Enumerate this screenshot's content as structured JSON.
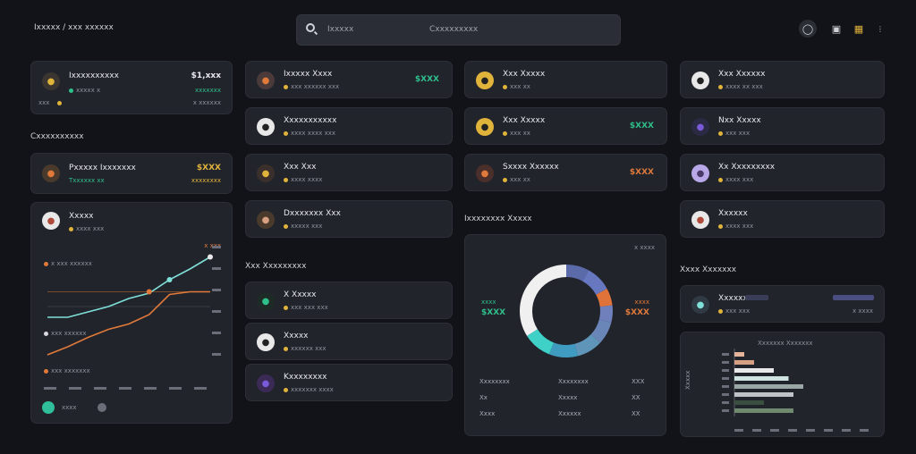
{
  "app": {
    "brand": "Ixxxxx / xxx xxxxxx"
  },
  "search": {
    "label": "Ixxxxx",
    "placeholder": "Cxxxxxxxxx"
  },
  "header": {
    "icons": [
      "globe-icon",
      "wallet-icon",
      "grid-icon",
      "more-icon"
    ]
  },
  "balance": {
    "title": "Ixxxxxxxxxx",
    "value": "$1,xxx",
    "sub": "xxxxx x",
    "sub_right": "xxxxxxx",
    "foot_left": "xxx",
    "foot_right": "x xxxxxx"
  },
  "col1": {
    "section_title": "Cxxxxxxxxxx",
    "top_card": {
      "title": "Pxxxxx Ixxxxxxx",
      "value": "$XXX",
      "sub": "Txxxxxx xx",
      "sub_right": "xxxxxxxx"
    },
    "chart_card": {
      "title": "Xxxxx",
      "sub": "xxxx xxx",
      "legend_1": "x xxx xxxxxx",
      "legend_2": "xxx xxxxxx",
      "legend_3": "xxx xxxxxxx",
      "corner": "x xxx",
      "foot": "xxxx"
    }
  },
  "col2": {
    "items": [
      {
        "title": "Ixxxxx Xxxx",
        "sub": "xxx xxxxxx xxx",
        "value": "$XXX",
        "color": "#2fbf8a"
      },
      {
        "title": "Xxxxxxxxxxx",
        "sub": "xxxx xxxx xxx",
        "value": "",
        "color": "#2fbf8a"
      },
      {
        "title": "Xxx Xxx",
        "sub": "xxxx xxxx",
        "value": "",
        "color": "#2fbf8a"
      },
      {
        "title": "Dxxxxxxx Xxx",
        "sub": "xxxxx xxx",
        "value": "",
        "color": "#2fbf8a"
      }
    ],
    "section_title": "Xxx Xxxxxxxxx",
    "items2": [
      {
        "title": "X Xxxxx",
        "sub": "xxx xxx xxx"
      },
      {
        "title": "Xxxxx",
        "sub": "xxxxxx xxx"
      },
      {
        "title": "Kxxxxxxxx",
        "sub": "xxxxxxx xxxx"
      }
    ]
  },
  "col3": {
    "items": [
      {
        "title": "Xxx Xxxxx",
        "sub": "xxx xx",
        "value": ""
      },
      {
        "title": "Xxx Xxxxx",
        "sub": "xxx xx",
        "value": "$XXX"
      },
      {
        "title": "Sxxxx Xxxxxx",
        "sub": "xxx xx",
        "value": "$XXX"
      }
    ],
    "section_title": "Ixxxxxxxx Xxxxx",
    "donut_card": {
      "corner": "x xxxx",
      "left_label": "xxxx",
      "left_value": "$XXX",
      "right_label": "xxxx",
      "right_value": "$XXX",
      "table": [
        [
          "Xxxxxxxx",
          "Xxxxxxxx",
          "XXX"
        ],
        [
          "Xx",
          "Xxxxx",
          "XX"
        ],
        [
          "Xxxx",
          "Xxxxxx",
          "XX"
        ]
      ]
    }
  },
  "col4": {
    "items": [
      {
        "title": "Xxx Xxxxxx",
        "sub": "xxxx xx xxx"
      },
      {
        "title": "Nxx Xxxxx",
        "sub": "xxx xxx"
      },
      {
        "title": "Xx Xxxxxxxxx",
        "sub": "xxxx xxx"
      },
      {
        "title": "Xxxxxx",
        "sub": "xxxx xxx"
      }
    ],
    "section_title": "Xxxx Xxxxxxx",
    "wallet_row": {
      "title": "Xxxxxx",
      "sub": "xxx xxx",
      "value": "xxxx",
      "value2": "x xxxx"
    },
    "bar_card": {
      "title": "Xxxxxxx Xxxxxxx",
      "y_label": "Xxxxx",
      "ticks": [
        "xxx",
        "xxx",
        "xxx",
        "xxx",
        "xxx",
        "xxx",
        "xxx",
        "xxx"
      ]
    }
  },
  "colors": {
    "accent_teal": "#7fe0d8",
    "accent_orange": "#e07a3a",
    "accent_green": "#2fbf8a",
    "accent_yellow": "#e0b33a",
    "accent_purple": "#7a5ad8"
  },
  "chart_data": [
    {
      "type": "line",
      "title": "",
      "x": [
        0,
        1,
        2,
        3,
        4,
        5,
        6,
        7,
        8
      ],
      "series": [
        {
          "name": "",
          "values": [
            48,
            48,
            52,
            56,
            62,
            66,
            76,
            84,
            93
          ]
        },
        {
          "name": "",
          "values": [
            20,
            26,
            33,
            39,
            43,
            50,
            65,
            67,
            67
          ]
        }
      ],
      "ylim": [
        0,
        100
      ]
    },
    {
      "type": "pie",
      "values": [
        8,
        9,
        6,
        6,
        8,
        9,
        10,
        10,
        34
      ],
      "colors": [
        "#5b6aa8",
        "#6777c0",
        "#e0733a",
        "#6f80bd",
        "#6a86b8",
        "#5f95b9",
        "#3f9bc0",
        "#3fd0c8",
        "#f0f0f0"
      ]
    },
    {
      "type": "bar",
      "categories": [
        "a",
        "b",
        "c",
        "d",
        "e",
        "f",
        "g",
        "h"
      ],
      "values": [
        10,
        20,
        40,
        55,
        70,
        60,
        30,
        60
      ],
      "colors": [
        "#e3b49a",
        "#d8a082",
        "#e8e8e8",
        "#cfe3e0",
        "#9aa7a5",
        "#c0c4c8",
        "#3a4f3f",
        "#6f8a6e"
      ]
    }
  ]
}
